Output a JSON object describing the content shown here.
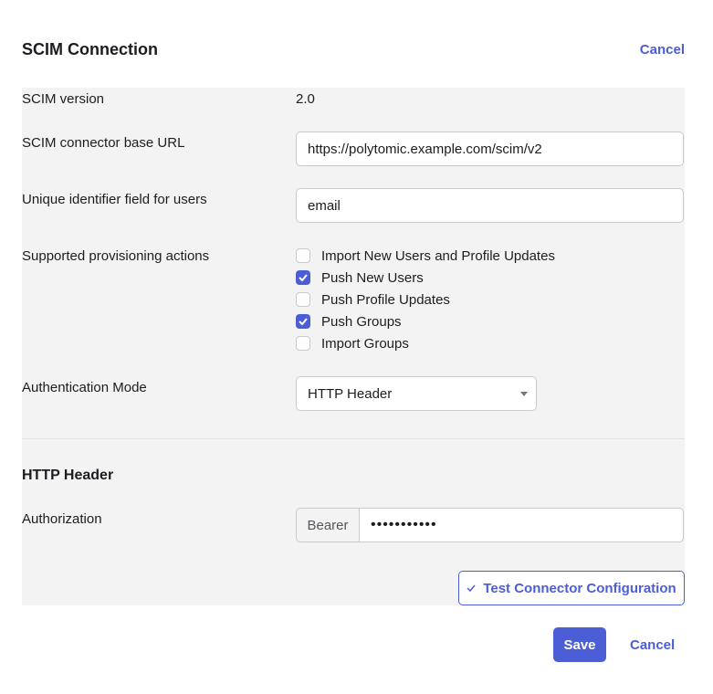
{
  "header": {
    "title": "SCIM Connection",
    "cancel_label": "Cancel"
  },
  "form": {
    "scim_version": {
      "label": "SCIM version",
      "value": "2.0"
    },
    "base_url": {
      "label": "SCIM connector base URL",
      "value": "https://polytomic.example.com/scim/v2"
    },
    "unique_id": {
      "label": "Unique identifier field for users",
      "value": "email"
    },
    "provisioning": {
      "label": "Supported provisioning actions",
      "options": [
        {
          "label": "Import New Users and Profile Updates",
          "checked": false
        },
        {
          "label": "Push New Users",
          "checked": true
        },
        {
          "label": "Push Profile Updates",
          "checked": false
        },
        {
          "label": "Push Groups",
          "checked": true
        },
        {
          "label": "Import Groups",
          "checked": false
        }
      ]
    },
    "auth_mode": {
      "label": "Authentication Mode",
      "selected": "HTTP Header"
    }
  },
  "http_header": {
    "section_title": "HTTP Header",
    "authorization": {
      "label": "Authorization",
      "prefix": "Bearer",
      "value": "•••••••••••"
    },
    "test_button_label": "Test Connector Configuration"
  },
  "footer": {
    "save_label": "Save",
    "cancel_label": "Cancel"
  },
  "colors": {
    "accent": "#4c5ed6",
    "panel_bg": "#f3f3f3",
    "border": "#c9c9cf"
  },
  "icons": {
    "checkbox_check": "check-icon",
    "select_caret": "caret-down-icon",
    "test_button": "check-icon"
  }
}
